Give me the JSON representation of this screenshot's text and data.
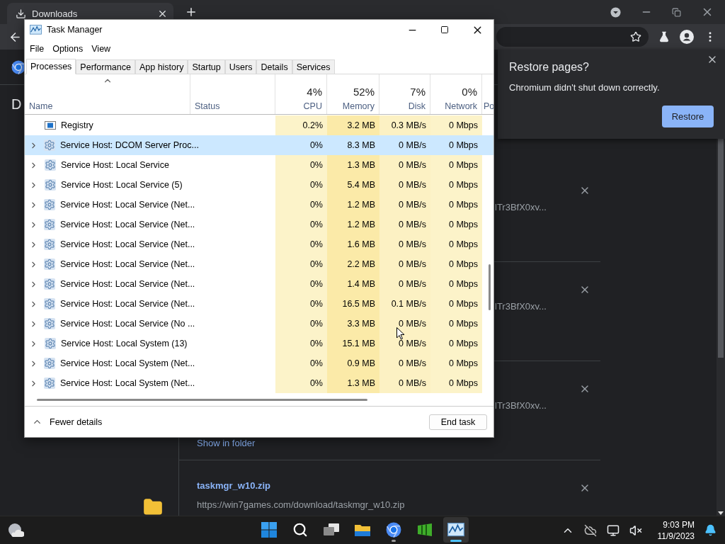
{
  "browser": {
    "tab": {
      "title": "Downloads"
    }
  },
  "downloads_page": {
    "heading": "D",
    "items": [
      {
        "kind": "cut",
        "url": "lTr3BfX0xv..."
      },
      {
        "kind": "cut",
        "url": "lTr3BfX0xv..."
      },
      {
        "kind": "cut",
        "url": "lTr3BfX0xv...",
        "action": "Show in folder"
      },
      {
        "kind": "file",
        "name": "taskmgr_w10.zip",
        "url": "https://win7games.com/download/taskmgr_w10.zip"
      }
    ]
  },
  "restore_popup": {
    "title": "Restore pages?",
    "message": "Chromium didn't shut down correctly.",
    "button": "Restore"
  },
  "task_manager": {
    "title": "Task Manager",
    "menu": [
      "File",
      "Options",
      "View"
    ],
    "tabs": [
      {
        "label": "Processes",
        "selected": true
      },
      {
        "label": "Performance",
        "selected": false
      },
      {
        "label": "App history",
        "selected": false
      },
      {
        "label": "Startup",
        "selected": false
      },
      {
        "label": "Users",
        "selected": false
      },
      {
        "label": "Details",
        "selected": false
      },
      {
        "label": "Services",
        "selected": false
      }
    ],
    "columns": [
      {
        "kind": "sorted",
        "label": "Name"
      },
      {
        "kind": "text",
        "label": "Status"
      },
      {
        "kind": "metric",
        "total": "4%",
        "label": "CPU"
      },
      {
        "kind": "metric",
        "total": "52%",
        "label": "Memory"
      },
      {
        "kind": "metric",
        "total": "7%",
        "label": "Disk"
      },
      {
        "kind": "metric",
        "total": "0%",
        "label": "Network"
      },
      {
        "kind": "cut",
        "label": "Po"
      }
    ],
    "rows": [
      {
        "name": "Registry",
        "kind": "registry",
        "expandable": false,
        "selected": false,
        "values": [
          "0.2%",
          "3.2 MB",
          "0.3 MB/s",
          "0 Mbps"
        ]
      },
      {
        "name": "Service Host: DCOM Server Proc...",
        "kind": "service",
        "expandable": true,
        "selected": true,
        "values": [
          "0%",
          "8.3 MB",
          "0 MB/s",
          "0 Mbps"
        ]
      },
      {
        "name": "Service Host: Local Service",
        "kind": "service",
        "expandable": true,
        "selected": false,
        "values": [
          "0%",
          "1.3 MB",
          "0 MB/s",
          "0 Mbps"
        ]
      },
      {
        "name": "Service Host: Local Service (5)",
        "kind": "service",
        "expandable": true,
        "selected": false,
        "values": [
          "0%",
          "5.4 MB",
          "0 MB/s",
          "0 Mbps"
        ]
      },
      {
        "name": "Service Host: Local Service (Net...",
        "kind": "service",
        "expandable": true,
        "selected": false,
        "values": [
          "0%",
          "1.2 MB",
          "0 MB/s",
          "0 Mbps"
        ]
      },
      {
        "name": "Service Host: Local Service (Net...",
        "kind": "service",
        "expandable": true,
        "selected": false,
        "values": [
          "0%",
          "1.2 MB",
          "0 MB/s",
          "0 Mbps"
        ]
      },
      {
        "name": "Service Host: Local Service (Net...",
        "kind": "service",
        "expandable": true,
        "selected": false,
        "values": [
          "0%",
          "1.6 MB",
          "0 MB/s",
          "0 Mbps"
        ]
      },
      {
        "name": "Service Host: Local Service (Net...",
        "kind": "service",
        "expandable": true,
        "selected": false,
        "values": [
          "0%",
          "2.2 MB",
          "0 MB/s",
          "0 Mbps"
        ]
      },
      {
        "name": "Service Host: Local Service (Net...",
        "kind": "service",
        "expandable": true,
        "selected": false,
        "values": [
          "0%",
          "1.4 MB",
          "0 MB/s",
          "0 Mbps"
        ]
      },
      {
        "name": "Service Host: Local Service (Net...",
        "kind": "service",
        "expandable": true,
        "selected": false,
        "values": [
          "0%",
          "16.5 MB",
          "0.1 MB/s",
          "0 Mbps"
        ]
      },
      {
        "name": "Service Host: Local Service (No ...",
        "kind": "service",
        "expandable": true,
        "selected": false,
        "values": [
          "0%",
          "3.3 MB",
          "0 MB/s",
          "0 Mbps"
        ]
      },
      {
        "name": "Service Host: Local System (13)",
        "kind": "service",
        "expandable": true,
        "selected": false,
        "values": [
          "0%",
          "15.1 MB",
          "0 MB/s",
          "0 Mbps"
        ]
      },
      {
        "name": "Service Host: Local System (Net...",
        "kind": "service",
        "expandable": true,
        "selected": false,
        "values": [
          "0%",
          "0.9 MB",
          "0 MB/s",
          "0 Mbps"
        ]
      },
      {
        "name": "Service Host: Local System (Net...",
        "kind": "service",
        "expandable": true,
        "selected": false,
        "values": [
          "0%",
          "1.3 MB",
          "0 MB/s",
          "0 Mbps"
        ]
      }
    ],
    "footer": {
      "toggle": "Fewer details",
      "button": "End task"
    }
  },
  "taskbar": {
    "apps": [
      {
        "kind": "start",
        "active": false,
        "running": false
      },
      {
        "kind": "search",
        "active": false,
        "running": false
      },
      {
        "kind": "taskview",
        "active": false,
        "running": false
      },
      {
        "kind": "explorer",
        "active": false,
        "running": false
      },
      {
        "kind": "chromium",
        "active": false,
        "running": true
      },
      {
        "kind": "green",
        "active": false,
        "running": false
      },
      {
        "kind": "taskmgr",
        "active": true,
        "running": true
      }
    ],
    "time": "9:03 PM",
    "date": "11/9/2023"
  }
}
